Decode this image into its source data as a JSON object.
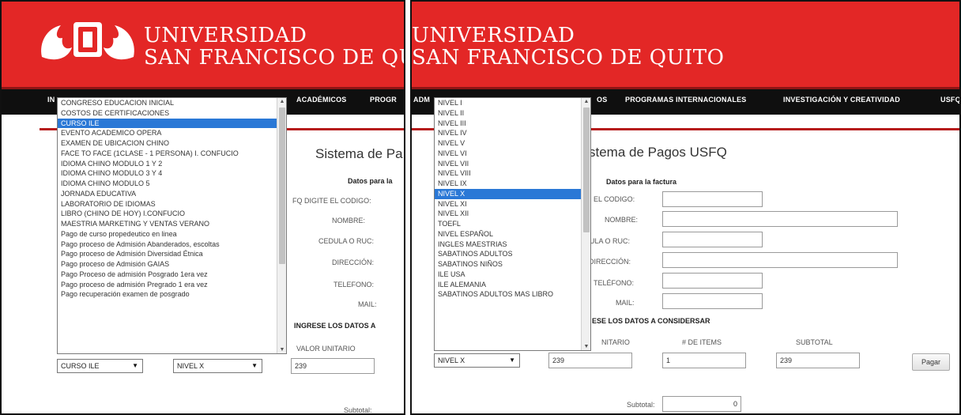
{
  "brand": {
    "line1": "UNIVERSIDAD",
    "line2": "SAN FRANCISCO DE QUITO"
  },
  "left": {
    "nav": [
      "IN",
      "ACADÉMICOS",
      "PROGR"
    ],
    "dropdown_items": [
      "CONGRESO EDUCACION INICIAL",
      "COSTOS DE CERTIFICACIONES",
      "CURSO ILE",
      "EVENTO ACADEMICO OPERA",
      "EXAMEN DE UBICACION CHINO",
      "FACE TO FACE (1CLASE - 1 PERSONA) I. CONFUCIO",
      "IDIOMA CHINO MODULO 1 Y 2",
      "IDIOMA CHINO MODULO 3 Y 4",
      "IDIOMA CHINO MODULO 5",
      "JORNADA EDUCATIVA",
      "LABORATORIO DE IDIOMAS",
      "LIBRO (CHINO DE HOY) I.CONFUCIO",
      "MAESTRIA MARKETING Y VENTAS VERANO",
      "Pago de curso propedeutico en linea",
      "Pago proceso de Admisión Abanderados, escoltas",
      "Pago proceso de Admisión Diversidad Étnica",
      "Pago proceso de Admisión GAIAS",
      "Pago Proceso de admisión Posgrado 1era vez",
      "Pago proceso de admisión Pregrado 1 era vez",
      "Pago recuperación examen de posgrado"
    ],
    "selected_index": 2,
    "heading": "Sistema de Pa",
    "datos": "Datos para la",
    "labels": [
      "FQ DIGITE EL CODIGO:",
      "NOMBRE:",
      "CEDULA O RUC:",
      "DIRECCIÓN:",
      "TELEFONO:",
      "MAIL:"
    ],
    "ingrese": "INGRESE LOS DATOS A",
    "valor_label": "VALOR UNITARIO",
    "select1": "CURSO ILE",
    "select2": "NIVEL X",
    "valor": "239",
    "subtotal_label": "Subtotal:"
  },
  "right": {
    "nav": [
      "ADM",
      "OS",
      "PROGRAMAS INTERNACIONALES",
      "INVESTIGACIÓN Y CREATIVIDAD",
      "USFQ"
    ],
    "dropdown_items": [
      "NIVEL I",
      "NIVEL II",
      "NIVEL III",
      "NIVEL IV",
      "NIVEL V",
      "NIVEL VI",
      "NIVEL VII",
      "NIVEL VIII",
      "NIVEL IX",
      "NIVEL X",
      "NIVEL XI",
      "NIVEL XII",
      "TOEFL",
      "NIVEL ESPAÑOL",
      "INGLES MAESTRIAS",
      "SABATINOS ADULTOS",
      "SABATINOS NIÑOS",
      "ILE USA",
      "ILE ALEMANIA",
      "SABATINOS ADULTOS MAS LIBRO"
    ],
    "selected_index": 9,
    "heading": "stema de Pagos USFQ",
    "datos": "Datos para la factura",
    "labels": [
      "EL CODIGO:",
      "NOMBRE:",
      "ULA O RUC:",
      "DIRECCIÓN:",
      "TELÉFONO:",
      "MAIL:"
    ],
    "ingrese": "ESE LOS DATOS A CONSIDERSAR",
    "col_headers": [
      "NITARIO",
      "# DE ITEMS",
      "SUBTOTAL"
    ],
    "select": "NIVEL X",
    "valor": "239",
    "items": "1",
    "subtotal": "239",
    "pay_label": "Pagar",
    "subtotal_label": "Subtotal:",
    "subtotal_value": "0"
  },
  "colors": {
    "red": "#e32726",
    "black": "#0f0f0f",
    "highlight": "#2a78d6"
  }
}
